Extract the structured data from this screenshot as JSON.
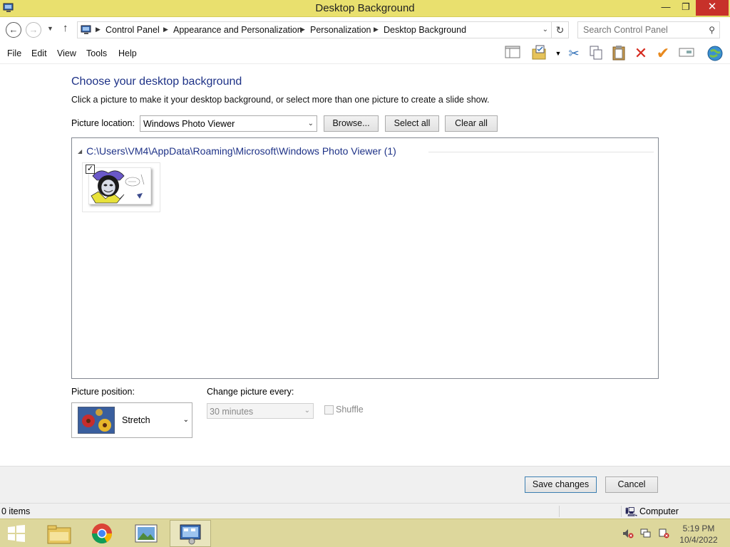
{
  "window": {
    "title": "Desktop Background",
    "minimize_glyph": "—",
    "restore_glyph": "❐",
    "close_glyph": "✕"
  },
  "address": {
    "breadcrumbs": [
      "Control Panel",
      "Appearance and Personalization",
      "Personalization",
      "Desktop Background"
    ],
    "search_placeholder": "Search Control Panel"
  },
  "menu": {
    "items": [
      "File",
      "Edit",
      "View",
      "Tools",
      "Help"
    ]
  },
  "toolbar": {
    "icons": [
      "layout-pane-icon",
      "properties-folder-icon",
      "cut-icon",
      "copy-icon",
      "paste-icon",
      "delete-icon",
      "checkmark-icon",
      "rename-icon",
      "globe-icon"
    ]
  },
  "main": {
    "heading": "Choose your desktop background",
    "description": "Click a picture to make it your desktop background, or select more than one picture to create a slide show.",
    "picture_location_label": "Picture location:",
    "picture_location_value": "Windows Photo Viewer",
    "browse_label": "Browse...",
    "select_all_label": "Select all",
    "clear_all_label": "Clear all",
    "group_header": "C:\\Users\\VM4\\AppData\\Roaming\\Microsoft\\Windows Photo Viewer (1)",
    "pictures": [
      {
        "checked": true,
        "description": "cartoon-jester-character"
      }
    ],
    "picture_position_label": "Picture position:",
    "picture_position_value": "Stretch",
    "change_every_label": "Change picture every:",
    "change_every_value": "30 minutes",
    "shuffle_label": "Shuffle"
  },
  "footer": {
    "save_label": "Save changes",
    "cancel_label": "Cancel"
  },
  "status": {
    "items": "0 items",
    "location": "Computer"
  },
  "taskbar": {
    "apps": [
      "file-explorer",
      "chrome",
      "photo-viewer",
      "control-panel"
    ],
    "active_app": "control-panel",
    "time": "5:19 PM",
    "date": "10/4/2022"
  },
  "colors": {
    "titlebar": "#e9e06e",
    "taskbar": "#ddd79c",
    "heading": "#1e3287",
    "close_button": "#c7312a"
  }
}
